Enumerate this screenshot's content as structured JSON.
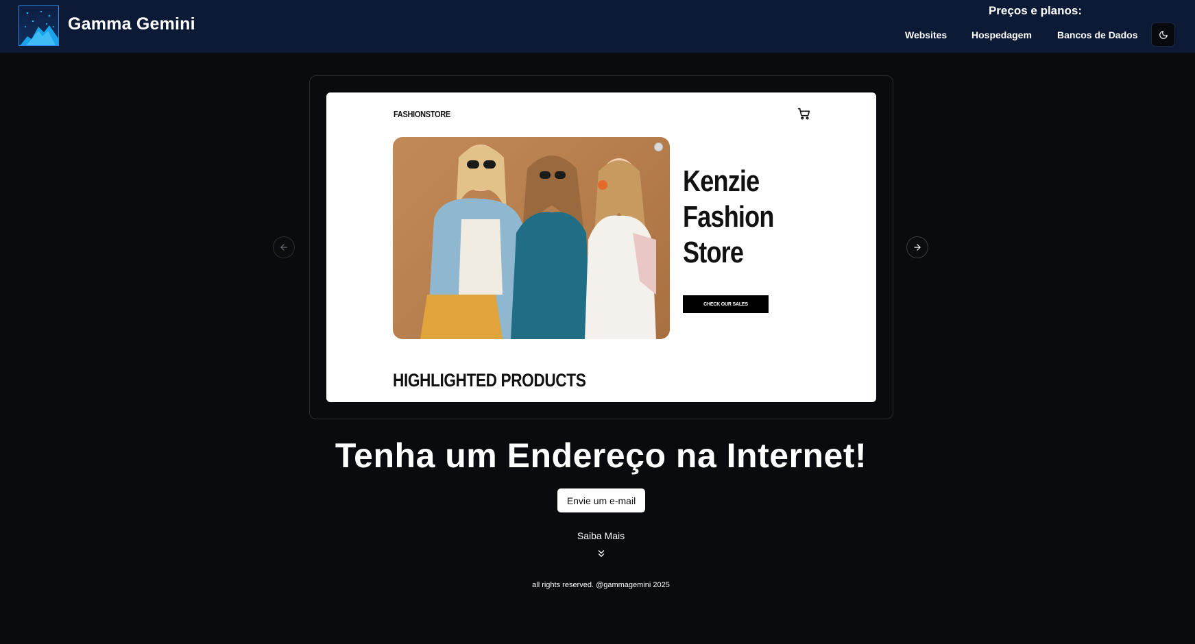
{
  "header": {
    "brand_name": "Gamma Gemini",
    "pricing_label": "Preços e planos:",
    "nav": [
      {
        "label": "Websites"
      },
      {
        "label": "Hospedagem"
      },
      {
        "label": "Bancos de Dados"
      }
    ],
    "theme_toggle_icon": "moon-icon"
  },
  "carousel": {
    "prev_icon": "arrow-left-icon",
    "next_icon": "arrow-right-icon",
    "slide": {
      "store_brand": "FASHIONSTORE",
      "cart_icon": "cart-icon",
      "hero_title_lines": [
        "Kenzie",
        "Fashion",
        "Store"
      ],
      "cta_label": "CHECK OUR SALES",
      "section_heading": "HIGHLIGHTED PRODUCTS",
      "photo_icon": "fashion-models-photo"
    }
  },
  "hero": {
    "headline": "Tenha um Endereço na Internet!",
    "email_button": "Envie um e-mail",
    "learn_more": "Saiba Mais",
    "learn_more_icon": "double-chevron-down-icon"
  },
  "footer": {
    "text": "all rights reserved. @gammagemini 2025"
  },
  "colors": {
    "background": "#0a0b0f",
    "header_bg": "#0c1a36",
    "logo_accent": "#29b6f6"
  }
}
